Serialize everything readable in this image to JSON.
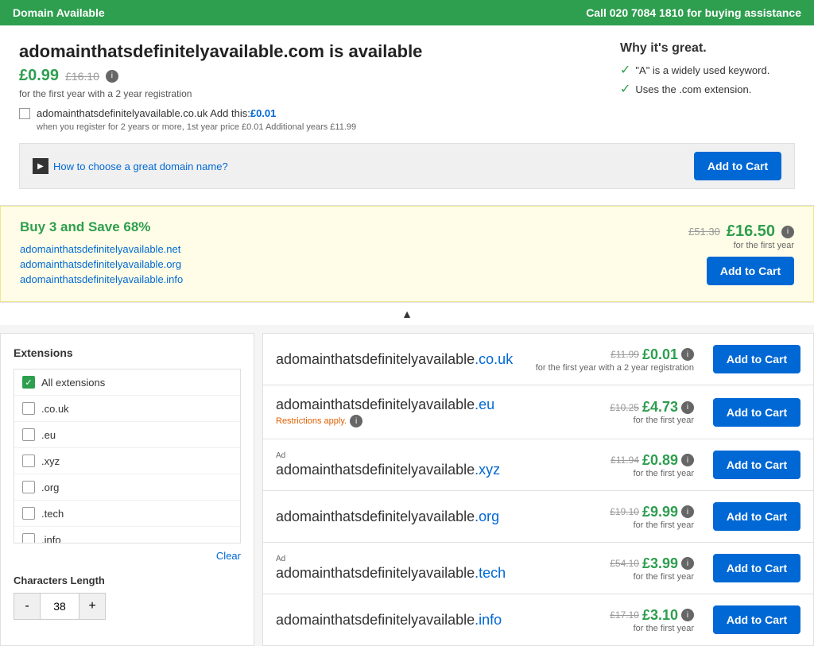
{
  "banner": {
    "left": "Domain Available",
    "right": "Call 020 7084 1810 for buying assistance"
  },
  "main": {
    "domain_title": "adomainthatsdefinitelyavailable.com is available",
    "price_current": "£0.99",
    "price_old": "£16.10",
    "price_note": "for the first year with a 2 year registration",
    "couk_label": "adomainthatsdefinitelyavailable.co.uk Add this:",
    "couk_add_price": "£0.01",
    "couk_note": "when you register for 2 years or more, 1st year price £0.01 Additional years £11.99",
    "add_to_cart": "Add to Cart",
    "how_to_link": "How to choose a great domain name?",
    "why_great_title": "Why it's great.",
    "why_great_items": [
      "\"A\" is a widely used keyword.",
      "Uses the .com extension."
    ]
  },
  "buy3": {
    "title": "Buy 3 and Save 68%",
    "domains": [
      "adomainthatsdefinitelyavailable.net",
      "adomainthatsdefinitelyavailable.org",
      "adomainthatsdefinitelyavailable.info"
    ],
    "old_price": "£51.30",
    "new_price": "£16.50",
    "price_note": "for the first year",
    "add_to_cart": "Add to Cart"
  },
  "extensions": {
    "title": "Extensions",
    "items": [
      {
        "label": "All extensions",
        "checked": true
      },
      {
        "label": ".co.uk",
        "checked": false
      },
      {
        "label": ".eu",
        "checked": false
      },
      {
        "label": ".xyz",
        "checked": false
      },
      {
        "label": ".org",
        "checked": false
      },
      {
        "label": ".tech",
        "checked": false
      },
      {
        "label": ".info",
        "checked": false
      }
    ],
    "clear_label": "Clear"
  },
  "char_length": {
    "title": "Characters Length",
    "value": "38",
    "minus": "-",
    "plus": "+"
  },
  "domain_list": [
    {
      "base": "adomainthatsdefinitelyavailable",
      "ext": ".co.uk",
      "ext_class": "ext-couk",
      "old_price": "£11.99",
      "new_price": "£0.01",
      "price_note": "for the first year with a 2 year registration",
      "ad": false,
      "restrictions": false,
      "add_to_cart": "Add to Cart"
    },
    {
      "base": "adomainthatsdefinitelyavailable",
      "ext": ".eu",
      "ext_class": "ext-eu",
      "old_price": "£10.25",
      "new_price": "£4.73",
      "price_note": "for the first year",
      "ad": false,
      "restrictions": true,
      "restrictions_text": "Restrictions apply.",
      "add_to_cart": "Add to Cart"
    },
    {
      "base": "adomainthatsdefinitelyavailable",
      "ext": ".xyz",
      "ext_class": "ext-xyz",
      "old_price": "£11.94",
      "new_price": "£0.89",
      "price_note": "for the first year",
      "ad": true,
      "ad_text": "Ad",
      "restrictions": false,
      "add_to_cart": "Add to Cart"
    },
    {
      "base": "adomainthatsdefinitelyavailable",
      "ext": ".org",
      "ext_class": "ext-org",
      "old_price": "£19.10",
      "new_price": "£9.99",
      "price_note": "for the first year",
      "ad": false,
      "restrictions": false,
      "add_to_cart": "Add to Cart"
    },
    {
      "base": "adomainthatsdefinitelyavailable",
      "ext": ".tech",
      "ext_class": "ext-tech",
      "old_price": "£54.10",
      "new_price": "£3.99",
      "price_note": "for the first year",
      "ad": true,
      "ad_text": "Ad",
      "restrictions": false,
      "add_to_cart": "Add to Cart"
    },
    {
      "base": "adomainthatsdefinitelyavailable",
      "ext": ".info",
      "ext_class": "ext-info",
      "old_price": "£17.10",
      "new_price": "£3.10",
      "price_note": "for the first year",
      "ad": false,
      "restrictions": false,
      "add_to_cart": "Add to Cart"
    }
  ]
}
